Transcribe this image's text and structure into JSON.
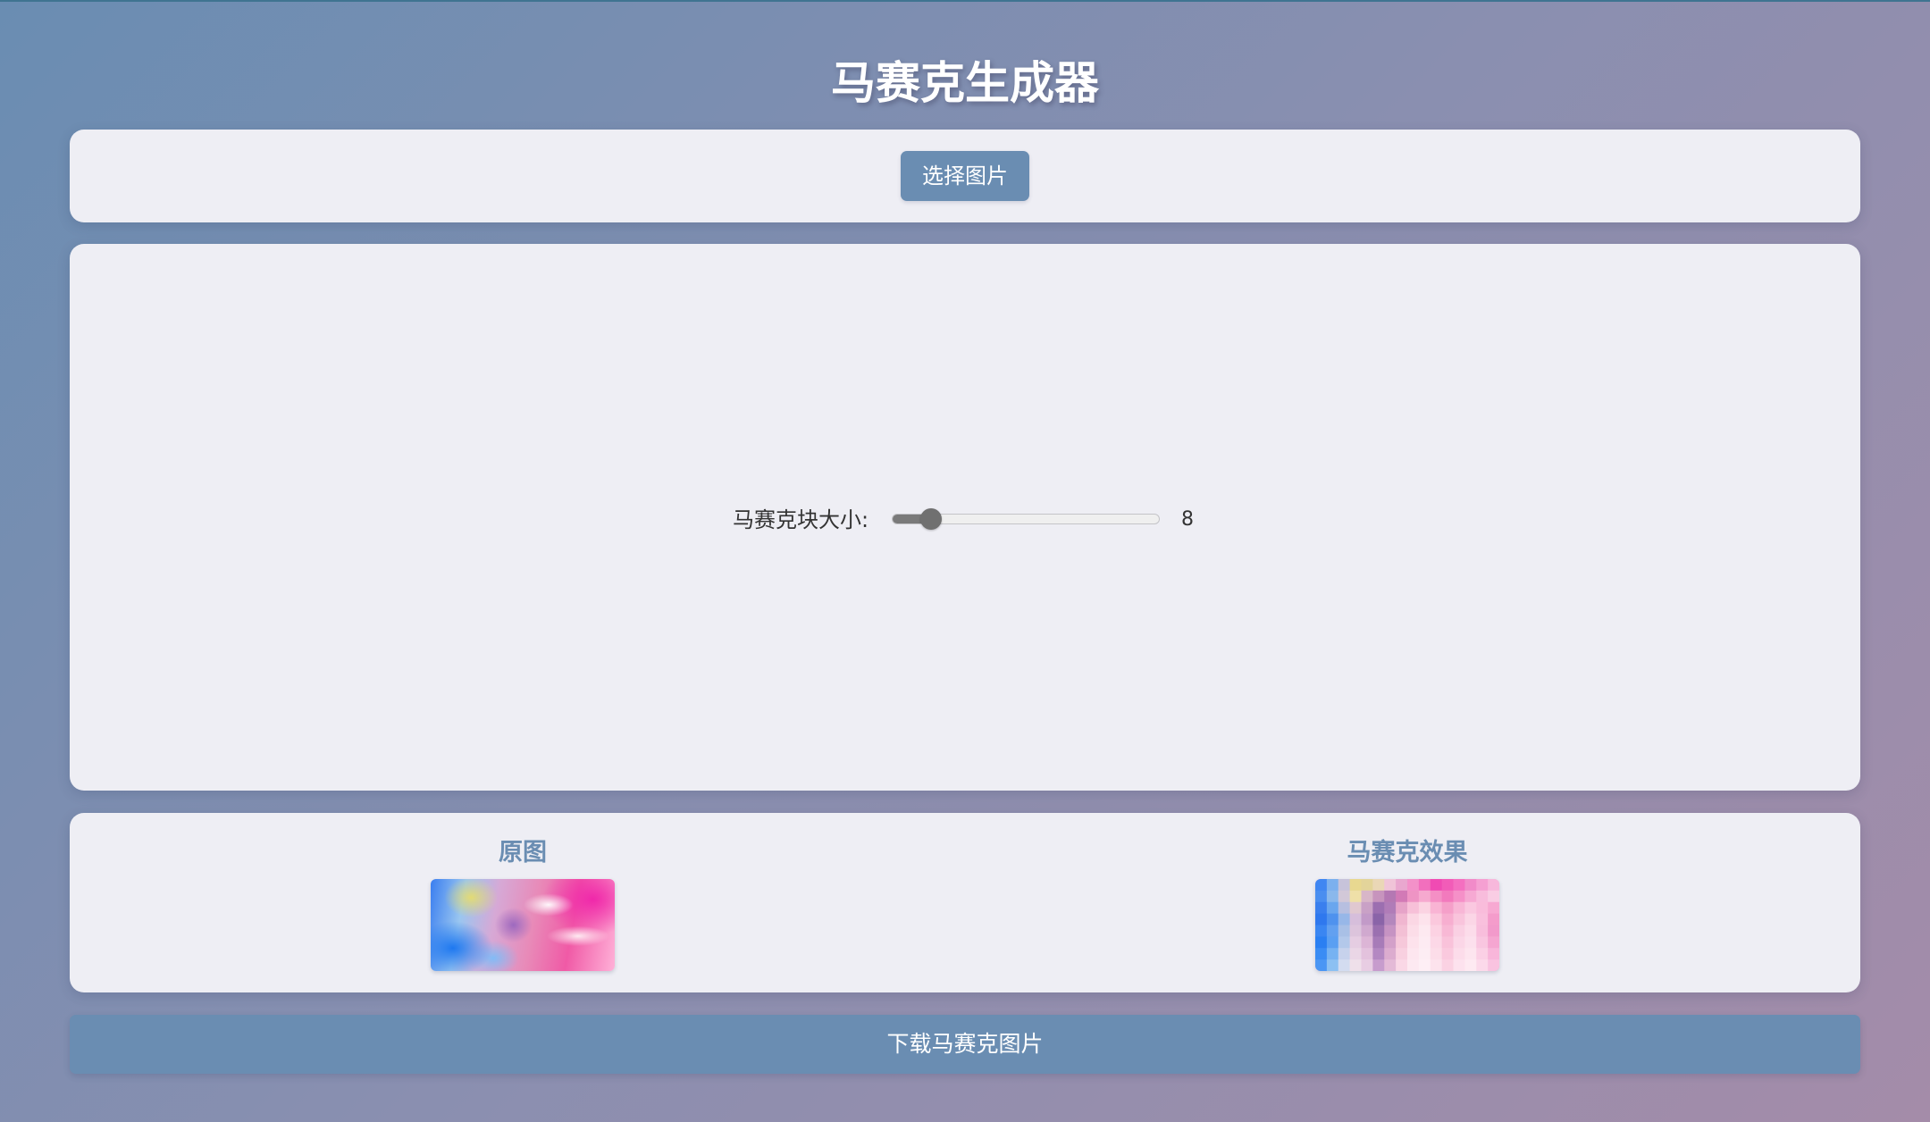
{
  "page": {
    "title": "马赛克生成器"
  },
  "upload": {
    "select_label": "选择图片"
  },
  "controls": {
    "block_size_label": "马赛克块大小:",
    "block_size_value": "8",
    "slider_min": 1,
    "slider_max": 50,
    "slider_value": 8
  },
  "preview": {
    "original_title": "原图",
    "mosaic_title": "马赛克效果"
  },
  "download": {
    "label": "下载马赛克图片"
  },
  "colors": {
    "accent": "#6a8db2",
    "card_background": "#eeeef4",
    "page_gradient_start": "#6a8db2",
    "page_gradient_end": "#a48ca9",
    "slider_fill": "#7a7a7a"
  }
}
